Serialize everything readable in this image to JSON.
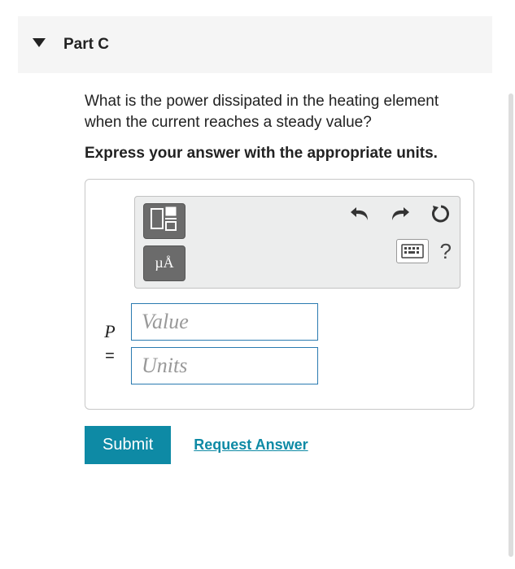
{
  "part": {
    "label": "Part C"
  },
  "question": "What is the power dissipated in the heating element when the current reaches a steady value?",
  "instruction": "Express your answer with the appropriate units.",
  "toolbar": {
    "units_button": "µÅ",
    "help_label": "?"
  },
  "answer": {
    "variable": "P",
    "equals": "=",
    "value_placeholder": "Value",
    "units_placeholder": "Units"
  },
  "actions": {
    "submit_label": "Submit",
    "request_label": "Request Answer"
  }
}
